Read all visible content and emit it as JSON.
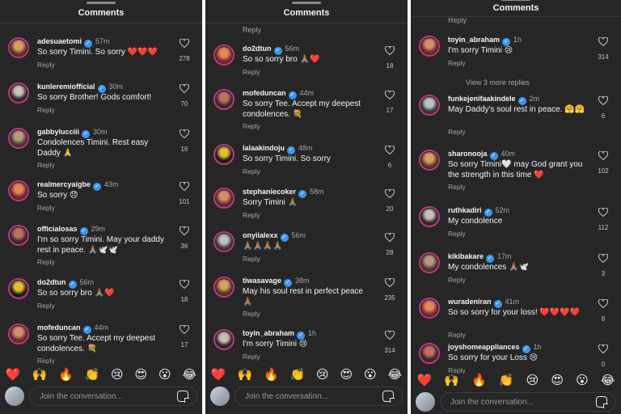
{
  "header": {
    "title": "Comments"
  },
  "composer": {
    "placeholder": "Join the conversation..."
  },
  "emoji_bar": [
    "❤️",
    "🙌",
    "🔥",
    "👏",
    "😢",
    "😍",
    "😮",
    "😂"
  ],
  "panels": [
    {
      "top_reply": "",
      "comments": [
        {
          "user": "adesuaetomi",
          "time": "57m",
          "text": "So sorry Timini. So sorry ❤️❤️❤️",
          "reply": "Reply",
          "likes": "278"
        },
        {
          "user": "kunleremiofficial",
          "time": "30m",
          "text": "So sorry Brother! Gods comfort!",
          "reply": "Reply",
          "likes": "70"
        },
        {
          "user": "gabbylucciii",
          "time": "30m",
          "text": "Condolences Timini. Rest easy Daddy 🙏",
          "reply": "Reply",
          "likes": "16"
        },
        {
          "user": "realmercyaigbe",
          "time": "43m",
          "text": "So sorry 😞",
          "reply": "Reply",
          "likes": "101"
        },
        {
          "user": "officialosas",
          "time": "29m",
          "text": "I'm so sorry Timini. May your daddy rest in peace. 🙏🏽🕊️🕊️",
          "reply": "Reply",
          "likes": "36"
        },
        {
          "user": "do2dtun",
          "time": "56m",
          "text": "So so sorry bro 🙏🏽❤️",
          "reply": "Reply",
          "likes": "18"
        },
        {
          "user": "mofeduncan",
          "time": "44m",
          "text": "So sorry Tee. Accept my deepest condolences. 💐",
          "reply": "Reply",
          "likes": "17"
        }
      ]
    },
    {
      "top_reply": "Reply",
      "comments": [
        {
          "user": "do2dtun",
          "time": "56m",
          "text": "So so sorry bro 🙏🏽❤️",
          "reply": "Reply",
          "likes": "18"
        },
        {
          "user": "mofeduncan",
          "time": "44m",
          "text": "So sorry Tee. Accept my deepest condolences. 💐",
          "reply": "Reply",
          "likes": "17"
        },
        {
          "user": "lalaakindoju",
          "time": "48m",
          "text": "So sorry Timini.  So sorry",
          "reply": "Reply",
          "likes": "6"
        },
        {
          "user": "stephaniecoker",
          "time": "58m",
          "text": "Sorry Timini 🙏🏽",
          "reply": "Reply",
          "likes": "20"
        },
        {
          "user": "onyiialexx",
          "time": "56m",
          "text": "🙏🏽🙏🏽🙏🏽🙏🏽",
          "reply": "Reply",
          "likes": "28"
        },
        {
          "user": "tiwasavage",
          "time": "38m",
          "text": "May his soul rest in perfect peace 🙏🏽",
          "reply": "Reply",
          "likes": "235"
        },
        {
          "user": "toyin_abraham",
          "time": "1h",
          "text": "I'm sorry Timini 😢",
          "reply": "Reply",
          "likes": "314"
        }
      ]
    },
    {
      "top_reply": "Reply",
      "view_more": "View 3 more replies",
      "comments": [
        {
          "user": "toyin_abraham",
          "time": "1h",
          "text": "I'm sorry Timini 😢",
          "reply": "Reply",
          "likes": "314"
        },
        {
          "user": "funkejenifaakindele",
          "time": "2m",
          "text": "May Daddy's soul rest in peace. 🤗🤗",
          "reply": "Reply",
          "likes": "6"
        },
        {
          "user": "sharonooja",
          "time": "40m",
          "text": "So sorry Timini🤍 may God grant you the strength in this time ❤️",
          "reply": "Reply",
          "likes": "102"
        },
        {
          "user": "ruthkadiri",
          "time": "52m",
          "text": "My condolence",
          "reply": "Reply",
          "likes": "112"
        },
        {
          "user": "kikibakare",
          "time": "17m",
          "text": "My condolences 🙏🏽🕊️",
          "reply": "Reply",
          "likes": "3"
        },
        {
          "user": "wuradeniran",
          "time": "41m",
          "text": "So so sorry for your loss! ❤️❤️❤️❤️",
          "reply": "Reply",
          "likes": "8"
        },
        {
          "user": "joyshomeappliances",
          "time": "1h",
          "text": "So sorry for your Loss 😢",
          "reply": "Reply",
          "likes": "0"
        }
      ]
    }
  ]
}
